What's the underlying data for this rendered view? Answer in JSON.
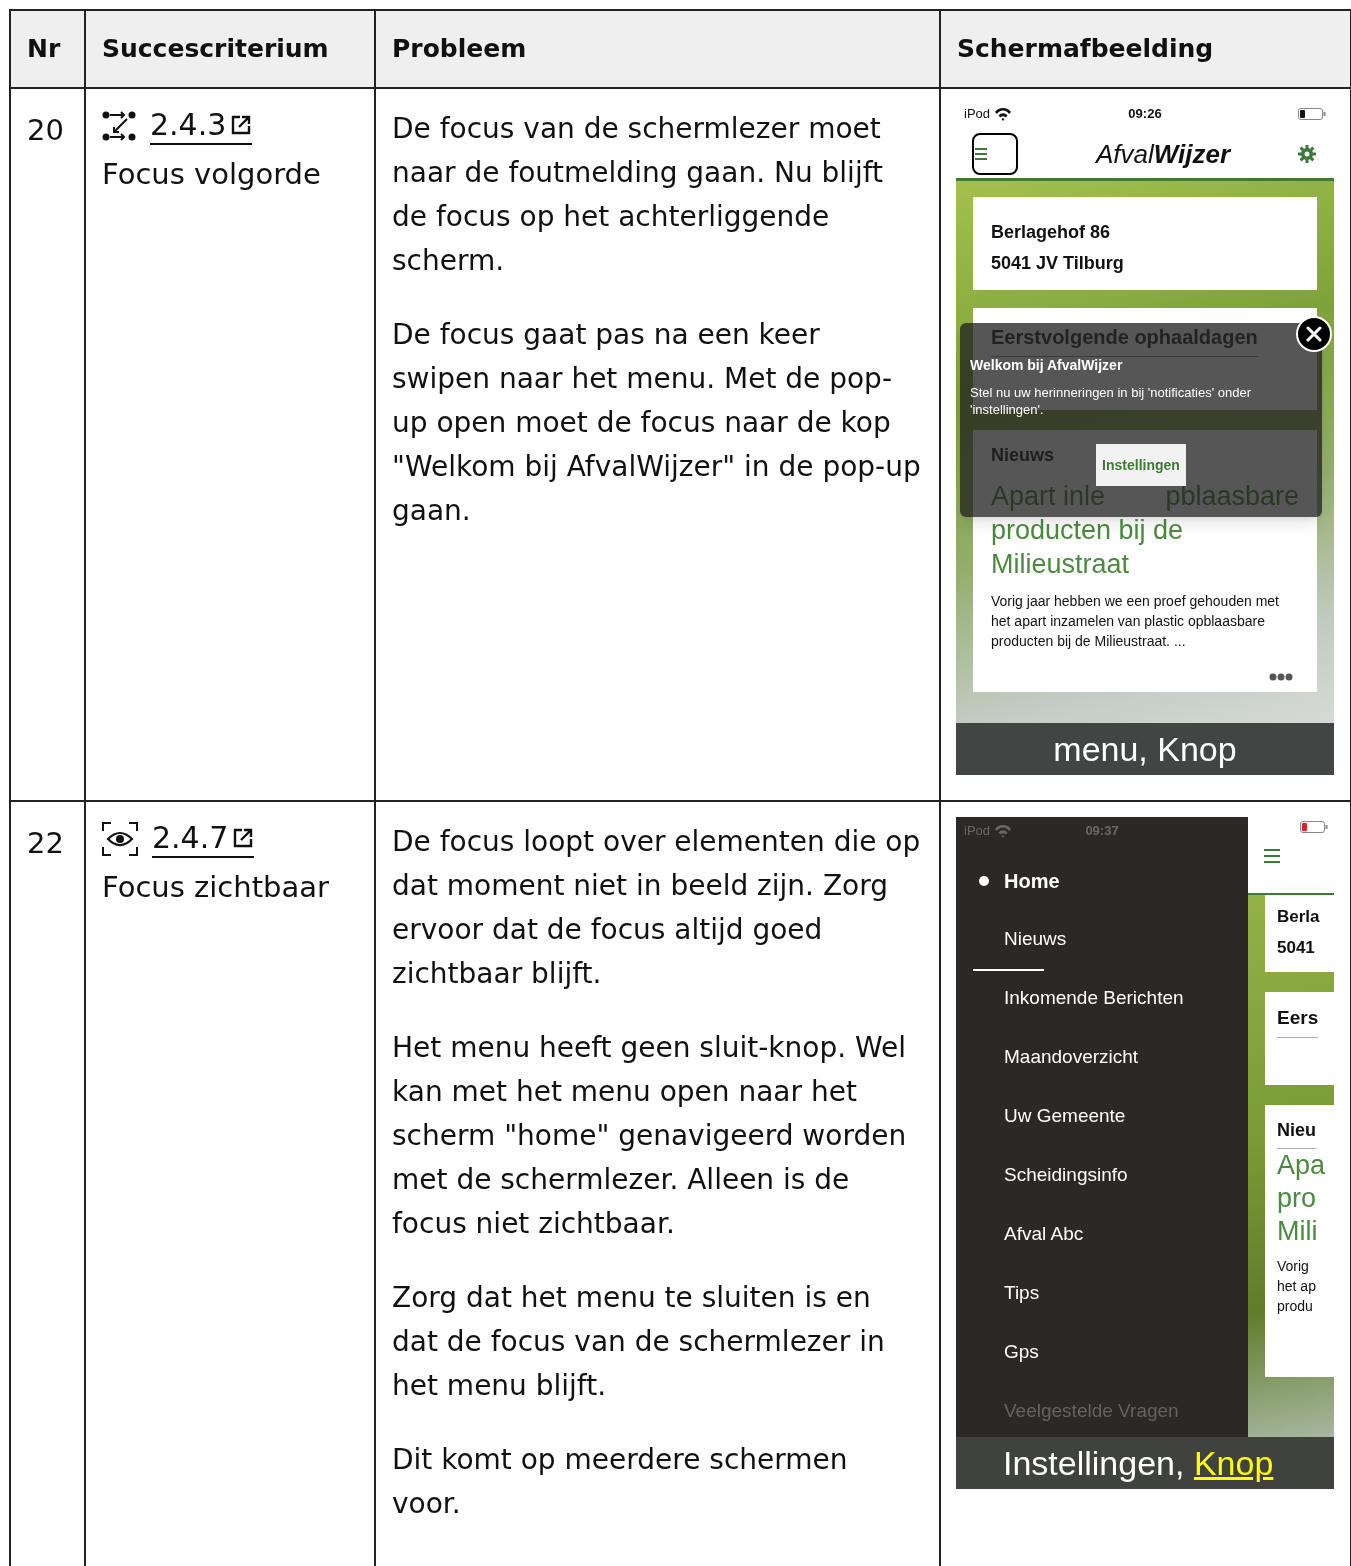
{
  "table": {
    "columns": [
      "Nr",
      "Succescriterium",
      "Probleem",
      "Schermafbeelding"
    ],
    "rows": [
      {
        "nr": "20",
        "criterion": {
          "kind": "order",
          "link": "2.4.3",
          "name": "Focus volgorde"
        },
        "problem": [
          "De focus van de schermlezer moet naar de foutmelding gaan. Nu blijft de focus op het achterliggende scherm.",
          "De focus gaat pas na een keer swipen naar het menu. Met de pop-up open moet de focus naar de kop \"Welkom bij AfvalWijzer\" in de pop-up gaan."
        ],
        "screenshot": {
          "kind": "popup",
          "status_bar": {
            "carrier": "iPod",
            "time": "09:26",
            "battery_low": false
          },
          "app_title": "Afval**Wijzer**",
          "address": [
            "Berlagehof 86",
            "5041 JV Tilburg"
          ],
          "section_heading": "Eerstvolgende ophaaldagen",
          "news_heading": "Nieuws",
          "news_title_parts": [
            "Apart inle",
            "pblaasbare",
            "producten bij de",
            "Milieustraat"
          ],
          "news_body": "Vorig jaar hebben we een proef gehouden met het apart inzamelen van plastic opblaasbare producten bij de Milieustraat. ...",
          "popup": {
            "title": "Welkom bij AfvalWijzer",
            "message": "Stel nu uw herinneringen in bij 'notificaties' onder 'instellingen'.",
            "button": "Instellingen"
          },
          "caption": "menu, Knop"
        }
      },
      {
        "nr": "22",
        "criterion": {
          "kind": "visible",
          "link": "2.4.7",
          "name": "Focus zichtbaar"
        },
        "problem": [
          "De focus loopt over elementen die op dat moment niet in beeld zijn. Zorg ervoor dat de focus altijd goed zichtbaar blijft.",
          "Het menu heeft geen sluit-knop. Wel kan met het menu open naar het scherm \"home\" genavigeerd worden met de schermlezer. Alleen is de focus niet zichtbaar.",
          "Zorg dat het menu te sluiten is en dat de focus van de schermlezer in het menu blijft.",
          "Dit komt op meerdere schermen voor."
        ],
        "screenshot": {
          "kind": "menu",
          "status_bar": {
            "carrier": "iPod",
            "time": "09:37",
            "battery_low": true
          },
          "menu_items": [
            {
              "label": "Home",
              "selected": true,
              "focused": false,
              "dimmed": false
            },
            {
              "label": "Nieuws",
              "selected": false,
              "focused": true,
              "dimmed": false
            },
            {
              "label": "Inkomende Berichten",
              "selected": false,
              "focused": false,
              "dimmed": false
            },
            {
              "label": "Maandoverzicht",
              "selected": false,
              "focused": false,
              "dimmed": false
            },
            {
              "label": "Uw Gemeente",
              "selected": false,
              "focused": false,
              "dimmed": false
            },
            {
              "label": "Scheidingsinfo",
              "selected": false,
              "focused": false,
              "dimmed": false
            },
            {
              "label": "Afval Abc",
              "selected": false,
              "focused": false,
              "dimmed": false
            },
            {
              "label": "Tips",
              "selected": false,
              "focused": false,
              "dimmed": false
            },
            {
              "label": "Gps",
              "selected": false,
              "focused": false,
              "dimmed": false
            },
            {
              "label": "Veelgestelde Vragen",
              "selected": false,
              "focused": false,
              "dimmed": true
            }
          ],
          "address": [
            "Berla",
            "5041"
          ],
          "section_heading": "Eers",
          "news_heading": "Nieu",
          "news_title_lines": [
            "Apa",
            "pro",
            "Mili"
          ],
          "news_body_lines": [
            "Vorig",
            "het ap",
            "produ"
          ],
          "caption": "Instellingen,",
          "caption_highlight": "Knop"
        }
      }
    ]
  }
}
